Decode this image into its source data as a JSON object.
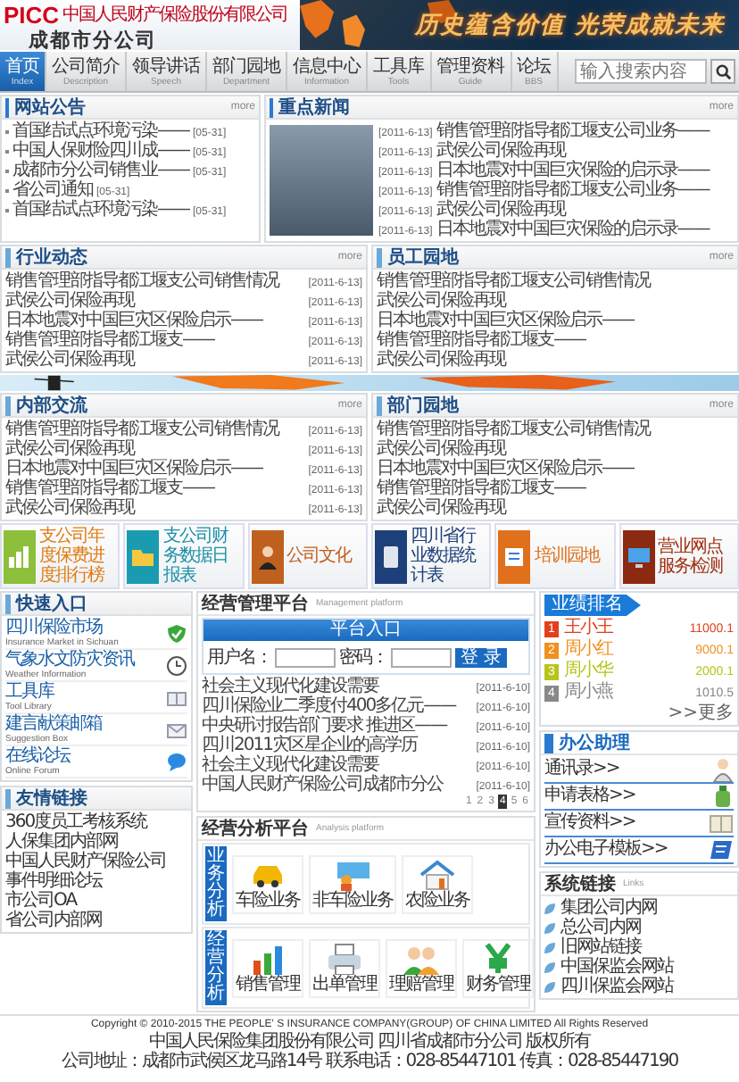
{
  "header": {
    "logo": "PICC",
    "company": "中国人民财产保险股份有限公司",
    "branch": "成都市分公司",
    "slogan": "历史蕴含价值 光荣成就未来"
  },
  "nav": {
    "items": [
      {
        "label": "首页",
        "sub": "Index",
        "selected": true
      },
      {
        "label": "公司简介",
        "sub": "Description",
        "selected": false
      },
      {
        "label": "领导讲话",
        "sub": "Speech",
        "selected": false
      },
      {
        "label": "部门园地",
        "sub": "Department",
        "selected": false
      },
      {
        "label": "信息中心",
        "sub": "Information",
        "selected": false
      },
      {
        "label": "工具库",
        "sub": "Tools",
        "selected": false
      },
      {
        "label": "管理资料",
        "sub": "Guide",
        "selected": false
      },
      {
        "label": "论坛",
        "sub": "BBS",
        "selected": false
      }
    ],
    "search": {
      "placeholder": "输入搜索内容"
    }
  },
  "notice": {
    "title": "网站公告",
    "more": "more",
    "items": [
      {
        "text": "首国结试点环境污染——",
        "date": "[05-31]"
      },
      {
        "text": "中国人保财险四川成——",
        "date": "[05-31]"
      },
      {
        "text": "成都市分公司销售业——",
        "date": "[05-31]"
      },
      {
        "text": "省公司通知",
        "date": "[05-31]"
      },
      {
        "text": "首国结试点环境污染——",
        "date": "[05-31]"
      }
    ]
  },
  "news": {
    "title": "重点新闻",
    "more": "more",
    "items": [
      {
        "date": "[2011-6-13]",
        "text": "销售管理部指导都江堰支公司业务——"
      },
      {
        "date": "[2011-6-13]",
        "text": "武侯公司保险再现"
      },
      {
        "date": "[2011-6-13]",
        "text": "日本地震对中国巨灾保险的启示录——"
      },
      {
        "date": "[2011-6-13]",
        "text": "销售管理部指导都江堰支公司业务——"
      },
      {
        "date": "[2011-6-13]",
        "text": "武侯公司保险再现"
      },
      {
        "date": "[2011-6-13]",
        "text": "日本地震对中国巨灾保险的启示录——"
      }
    ]
  },
  "lists": [
    {
      "title": "行业动态",
      "more": "more",
      "items": [
        {
          "text": "销售管理部指导都江堰支公司销售情况",
          "date": "[2011-6-13]"
        },
        {
          "text": "武侯公司保险再现",
          "date": "[2011-6-13]"
        },
        {
          "text": "日本地震对中国巨灾区保险启示——",
          "date": "[2011-6-13]"
        },
        {
          "text": "销售管理部指导都江堰支——",
          "date": "[2011-6-13]"
        },
        {
          "text": "武侯公司保险再现",
          "date": "[2011-6-13]"
        }
      ]
    },
    {
      "title": "员工园地",
      "more": "more",
      "items": [
        {
          "text": "销售管理部指导都江堰支公司销售情况"
        },
        {
          "text": "武侯公司保险再现"
        },
        {
          "text": "日本地震对中国巨灾区保险启示——"
        },
        {
          "text": "销售管理部指导都江堰支——"
        },
        {
          "text": "武侯公司保险再现"
        }
      ]
    },
    {
      "title": "内部交流",
      "more": "more",
      "items": [
        {
          "text": "销售管理部指导都江堰支公司销售情况",
          "date": "[2011-6-13]"
        },
        {
          "text": "武侯公司保险再现",
          "date": "[2011-6-13]"
        },
        {
          "text": "日本地震对中国巨灾区保险启示——",
          "date": "[2011-6-13]"
        },
        {
          "text": "销售管理部指导都江堰支——",
          "date": "[2011-6-13]"
        },
        {
          "text": "武侯公司保险再现",
          "date": "[2011-6-13]"
        }
      ]
    },
    {
      "title": "部门园地",
      "more": "more",
      "items": [
        {
          "text": "销售管理部指导都江堰支公司销售情况"
        },
        {
          "text": "武侯公司保险再现"
        },
        {
          "text": "日本地震对中国巨灾区保险启示——"
        },
        {
          "text": "销售管理部指导都江堰支——"
        },
        {
          "text": "武侯公司保险再现"
        }
      ]
    }
  ],
  "menu": {
    "items": [
      {
        "label": "支公司年度保费进度排行榜",
        "kind": "chart"
      },
      {
        "label": "支公司财务数据日报表",
        "kind": "folder"
      },
      {
        "label": "公司文化",
        "kind": "person"
      },
      {
        "label": "四川省行业数据统计表",
        "kind": "tablet"
      },
      {
        "label": "培训园地",
        "kind": "board"
      },
      {
        "label": "营业网点服务检测",
        "kind": "monitor"
      }
    ]
  },
  "quick": {
    "title": "快速入口",
    "items": [
      {
        "label": "四川保险市场",
        "sub": "Insurance Market in Sichuan",
        "kind": "shield"
      },
      {
        "label": "气象水文防灾资讯",
        "sub": "Weather Information",
        "kind": "clock"
      },
      {
        "label": "工具库",
        "sub": "Tool Library",
        "kind": "book"
      },
      {
        "label": "建言献策邮箱",
        "sub": "Suggestion Box",
        "kind": "mail"
      },
      {
        "label": "在线论坛",
        "sub": "Online Forum",
        "kind": "chat"
      }
    ]
  },
  "friends": {
    "title": "友情链接",
    "items": [
      "360度员工考核系统",
      "人保集团内部网",
      "中国人民财产保险公司",
      "事件明细论坛",
      "市公司OA",
      "省公司内部网"
    ]
  },
  "platform": {
    "title": "经营管理平台",
    "subtitle": "Management platform",
    "login": {
      "title": "平台入口",
      "user_label": "用户名：",
      "password_label": "密码：",
      "button": "登 录"
    },
    "items": [
      {
        "text": "社会主义现代化建设需要",
        "date": "[2011-6-10]"
      },
      {
        "text": "四川保险业二季度付400多亿元——",
        "date": "[2011-6-10]"
      },
      {
        "text": "中央研讨报告部门要求 推进区——",
        "date": "[2011-6-10]"
      },
      {
        "text": "四川2011灾区星企业的高学历",
        "date": "[2011-6-10]"
      },
      {
        "text": "社会主义现代化建设需要",
        "date": "[2011-6-10]"
      },
      {
        "text": "中国人民财产保险公司成都市分公",
        "date": "[2011-6-10]"
      }
    ],
    "pages": [
      {
        "label": "1",
        "selected": false
      },
      {
        "label": "2",
        "selected": false
      },
      {
        "label": "3",
        "selected": false
      },
      {
        "label": "4",
        "selected": true
      },
      {
        "label": "5",
        "selected": false
      },
      {
        "label": "6",
        "selected": false
      }
    ]
  },
  "analysis": {
    "title": "经营分析平台",
    "subtitle": "Analysis platform",
    "groups": [
      {
        "tag": "业务分析",
        "items": [
          {
            "label": "车险业务",
            "kind": "car"
          },
          {
            "label": "非车险业务",
            "kind": "billboard"
          },
          {
            "label": "农险业务",
            "kind": "house"
          }
        ]
      },
      {
        "tag": "经营分析",
        "items": [
          {
            "label": "销售管理",
            "kind": "bars"
          },
          {
            "label": "出单管理",
            "kind": "printer"
          },
          {
            "label": "理赔管理",
            "kind": "people"
          },
          {
            "label": "财务管理",
            "kind": "yen"
          }
        ]
      }
    ]
  },
  "ranking": {
    "title": "业绩排名",
    "more": ">>更多",
    "items": [
      {
        "rank": "1",
        "name": "王小王",
        "value": "11000.1",
        "color": "#e2401c"
      },
      {
        "rank": "2",
        "name": "周小红",
        "value": "9000.1",
        "color": "#f0901e"
      },
      {
        "rank": "3",
        "name": "周小华",
        "value": "2000.1",
        "color": "#b8c41a"
      },
      {
        "rank": "4",
        "name": "周小燕",
        "value": "1010.5",
        "color": "#888888"
      }
    ]
  },
  "office": {
    "title": "办公助理",
    "items": [
      {
        "label": "通讯录>>",
        "kind": "person"
      },
      {
        "label": "申请表格>>",
        "kind": "bottle"
      },
      {
        "label": "宣传资料>>",
        "kind": "book"
      },
      {
        "label": "办公电子模板>>",
        "kind": "screen"
      }
    ]
  },
  "links": {
    "title": "系统链接",
    "subtitle": "Links",
    "items": [
      "集团公司内网",
      "总公司内网",
      "旧网站链接",
      "中国保监会网站",
      "四川保监会网站"
    ]
  },
  "footer": {
    "lines": [
      "Copyright © 2010-2015  THE PEOPLE' S INSURANCE COMPANY(GROUP) OF CHINA LIMITED All Rights Reserved",
      "中国人民保险集团股份有限公司 四川省成都市分公司 版权所有",
      "公司地址：成都市武侯区龙马路14号  联系电话：028-85447101  传真：028-85447190"
    ]
  }
}
